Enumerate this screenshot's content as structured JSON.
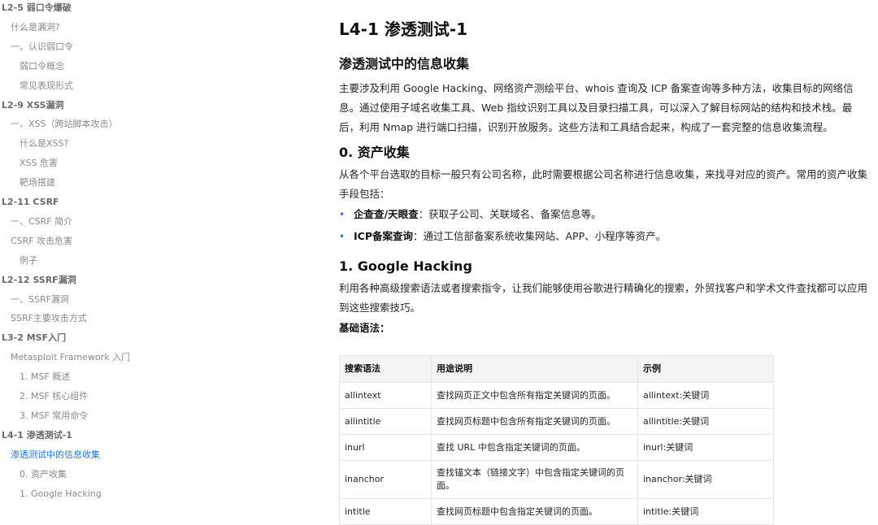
{
  "toc": [
    {
      "label": "L2-5 弱口令爆破",
      "level": 1
    },
    {
      "label": "什么是漏洞?",
      "level": 2
    },
    {
      "label": "一、认识弱口令",
      "level": 2
    },
    {
      "label": "弱口令概念",
      "level": 3
    },
    {
      "label": "常见表现形式",
      "level": 3
    },
    {
      "label": "L2-9 XSS漏洞",
      "level": 1
    },
    {
      "label": "一、XSS（跨站脚本攻击）",
      "level": 2
    },
    {
      "label": "什么是XSS?",
      "level": 3
    },
    {
      "label": "XSS 危害",
      "level": 3
    },
    {
      "label": "靶场搭建",
      "level": 3
    },
    {
      "label": "L2-11 CSRF",
      "level": 1
    },
    {
      "label": "一、CSRF 简介",
      "level": 2
    },
    {
      "label": "CSRF 攻击危害",
      "level": 2
    },
    {
      "label": "例子",
      "level": 3
    },
    {
      "label": "L2-12 SSRF漏洞",
      "level": 1
    },
    {
      "label": "一、SSRF漏洞",
      "level": 2
    },
    {
      "label": "SSRF主要攻击方式",
      "level": 2
    },
    {
      "label": "L3-2 MSF入门",
      "level": 1
    },
    {
      "label": "Metasploit Framework 入门",
      "level": 2
    },
    {
      "label": "1. MSF 概述",
      "level": 3
    },
    {
      "label": "2. MSF 核心组件",
      "level": 3
    },
    {
      "label": "3. MSF 常用命令",
      "level": 3
    },
    {
      "label": "L4-1 渗透测试-1",
      "level": 1
    },
    {
      "label": "渗透测试中的信息收集",
      "level": 2,
      "active": true
    },
    {
      "label": "0. 资产收集",
      "level": 3
    },
    {
      "label": "1. Google Hacking",
      "level": 3
    }
  ],
  "article": {
    "title": "L4-1 渗透测试-1",
    "section_title": "渗透测试中的信息收集",
    "intro": "主要涉及利用 Google Hacking、网络资产测绘平台、whois 查询及 ICP 备案查询等多种方法，收集目标的网络信息。通过使用子域名收集工具、Web 指纹识别工具以及目录扫描工具，可以深入了解目标网站的结构和技术栈。最后，利用 Nmap 进行端口扫描，识别开放服务。这些方法和工具结合起来，构成了一套完整的信息收集流程。",
    "asset_heading": "0. 资产收集",
    "asset_text": "从各个平台选取的目标一般只有公司名称，此时需要根据公司名称进行信息收集，来找寻对应的资产。常用的资产收集手段包括：",
    "bullets": [
      {
        "strong": "企查查/天眼查",
        "text": "：获取子公司、关联域名、备案信息等。"
      },
      {
        "strong": "ICP备案查询",
        "text": "：通过工信部备案系统收集网站、APP、小程序等资产。"
      }
    ],
    "google_heading": "1. Google Hacking",
    "google_text": "利用各种高级搜索语法或者搜索指令，让我们能够使用谷歌进行精确化的搜索，外贸找客户和学术文件查找都可以应用到这些搜索技巧。",
    "syntax_label": "基础语法：",
    "table": {
      "headers": [
        "搜索语法",
        "用途说明",
        "示例"
      ],
      "rows": [
        [
          "allintext",
          "查找网页正文中包含所有指定关键词的页面。",
          "allintext:关键词"
        ],
        [
          "allintitle",
          "查找网页标题中包含所有指定关键词的页面。",
          "allintitle:关键词"
        ],
        [
          "inurl",
          "查找 URL 中包含指定关键词的页面。",
          "inurl:关键词"
        ],
        [
          "inanchor",
          "查找锚文本（链接文字）中包含指定关键词的页面。",
          "inanchor:关键词"
        ],
        [
          "intitle",
          "查找网页标题中包含指定关键词的页面。",
          "intitle:关键词"
        ]
      ]
    }
  }
}
